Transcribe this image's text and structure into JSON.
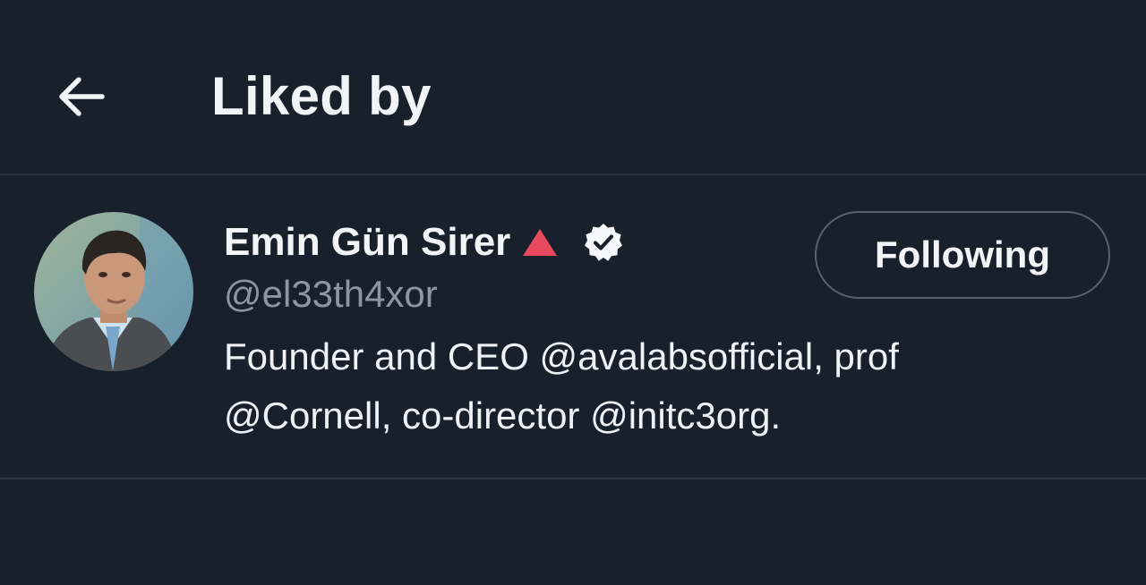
{
  "header": {
    "title": "Liked by",
    "back_icon": "arrow-left-icon"
  },
  "user": {
    "display_name": "Emin Gün Sirer",
    "name_emoji": "red-triangle-icon",
    "verified_icon": "verified-badge-icon",
    "handle": "@el33th4xor",
    "bio_line1": "Founder and CEO @avalabsofficial, prof",
    "bio_line2": "@Cornell, co-director @initc3org.",
    "follow_button_label": "Following"
  },
  "colors": {
    "background": "#17202b",
    "divider": "#2b3540",
    "text_primary": "#f2f5f8",
    "text_secondary": "#8a96a3",
    "button_border": "#56636f",
    "triangle": "#e8495f"
  }
}
